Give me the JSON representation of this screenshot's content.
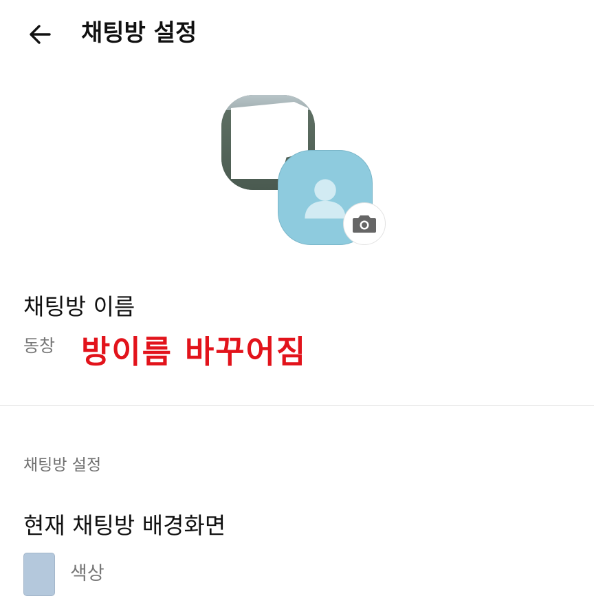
{
  "header": {
    "title": "채팅방 설정",
    "back_icon": "arrow-left-icon"
  },
  "profile": {
    "camera_icon": "camera-icon",
    "avatar_color": "#8ecbde"
  },
  "room_name": {
    "label": "채팅방 이름",
    "value": "동창",
    "annotation": "방이름 바꾸어짐",
    "annotation_color": "#e2131b"
  },
  "settings": {
    "section_title": "채팅방 설정",
    "background_label": "현재 채팅방 배경화면",
    "color_label": "색상",
    "swatch_color": "#b4c8dc"
  }
}
